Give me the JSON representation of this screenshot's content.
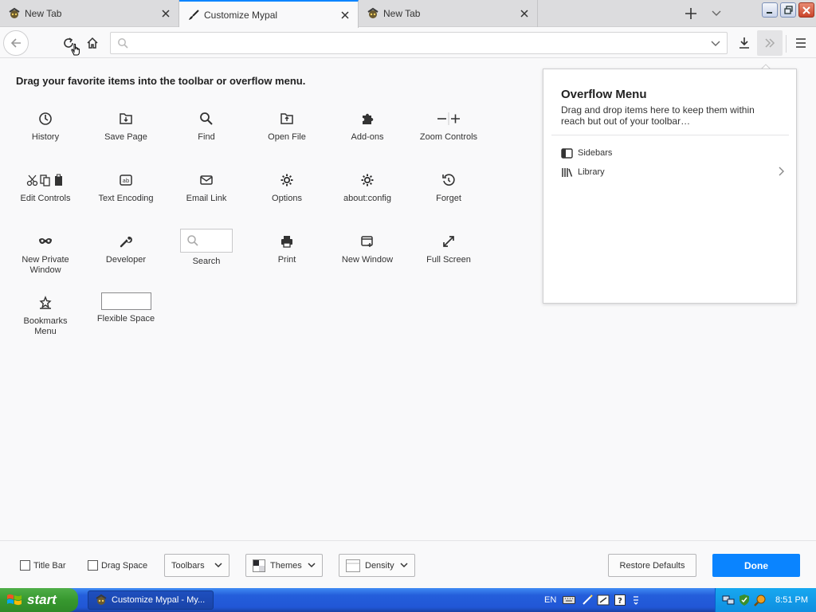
{
  "tabs": [
    {
      "label": "New Tab",
      "active": false,
      "icon": "mypal-icon"
    },
    {
      "label": "Customize Mypal",
      "active": true,
      "icon": "paintbrush-icon"
    },
    {
      "label": "New Tab",
      "active": false,
      "icon": "mypal-icon"
    }
  ],
  "navbar": {
    "url_value": "",
    "url_placeholder": ""
  },
  "main": {
    "heading": "Drag your favorite items into the toolbar or overflow menu.",
    "palette": [
      {
        "label": "History",
        "icon": "clock-icon"
      },
      {
        "label": "Save Page",
        "icon": "save-page-icon"
      },
      {
        "label": "Find",
        "icon": "magnifier-icon"
      },
      {
        "label": "Open File",
        "icon": "open-file-icon"
      },
      {
        "label": "Add-ons",
        "icon": "puzzle-icon"
      },
      {
        "label": "Zoom Controls",
        "icon": "zoom-icon"
      },
      {
        "label": "Edit Controls",
        "icon": "cut-copy-paste-icon"
      },
      {
        "label": "Text Encoding",
        "icon": "text-encoding-icon"
      },
      {
        "label": "Email Link",
        "icon": "envelope-icon"
      },
      {
        "label": "Options",
        "icon": "gear-icon"
      },
      {
        "label": "about:config",
        "icon": "gear-icon"
      },
      {
        "label": "Forget",
        "icon": "forget-icon"
      },
      {
        "label": "New Private Window",
        "icon": "mask-icon"
      },
      {
        "label": "Developer",
        "icon": "wrench-icon"
      },
      {
        "label": "Search",
        "icon": "search-box"
      },
      {
        "label": "Print",
        "icon": "printer-icon"
      },
      {
        "label": "New Window",
        "icon": "new-window-icon"
      },
      {
        "label": "Full Screen",
        "icon": "fullscreen-icon"
      },
      {
        "label": "Bookmarks Menu",
        "icon": "bookmarks-menu-icon"
      },
      {
        "label": "Flexible Space",
        "icon": "flexible-space"
      }
    ]
  },
  "overflow": {
    "title": "Overflow Menu",
    "description": "Drag and drop items here to keep them within reach but out of your toolbar…",
    "items": [
      {
        "label": "Sidebars",
        "icon": "sidebars-icon"
      },
      {
        "label": "Library",
        "icon": "library-icon"
      }
    ]
  },
  "footer": {
    "title_bar": "Title Bar",
    "drag_space": "Drag Space",
    "toolbars": "Toolbars",
    "themes": "Themes",
    "density": "Density",
    "restore": "Restore Defaults",
    "done": "Done"
  },
  "taskbar": {
    "start": "start",
    "window": "Customize Mypal - My...",
    "lang": "EN",
    "clock": "8:51 PM"
  },
  "colors": {
    "accent": "#0a84ff",
    "taskbar": "#245edb",
    "start": "#37982f"
  }
}
